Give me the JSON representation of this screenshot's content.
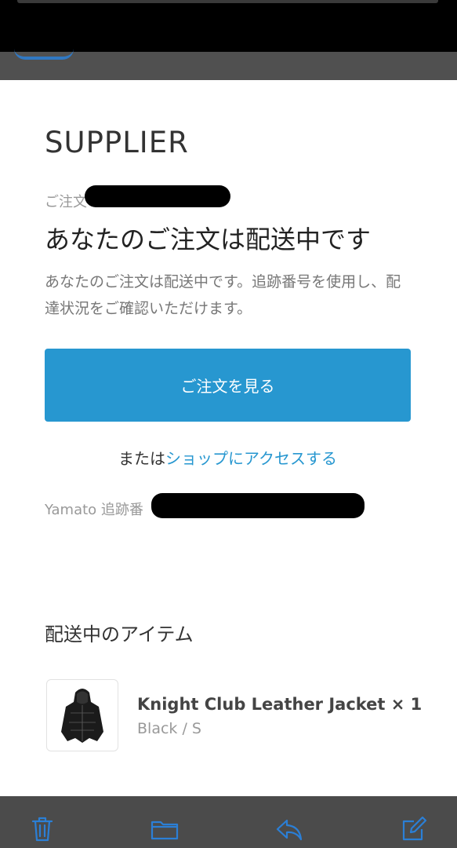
{
  "email": {
    "shop_name": "SUPPLIER",
    "order_number_label": "ご注文",
    "heading": "あなたのご注文は配送中です",
    "description": "あなたのご注文は配送中です。追跡番号を使用し、配達状況をご確認いただけます。",
    "view_order_button": "ご注文を見る",
    "or_text": "または",
    "shop_link": "ショップにアクセスする",
    "tracking_label": "Yamato 追跡番",
    "items_heading": "配送中のアイテム",
    "item": {
      "title": "Knight Club Leather Jacket × 1",
      "variant": "Black / S"
    }
  },
  "toolbar": {
    "icons": [
      "trash-icon",
      "folder-icon",
      "reply-icon",
      "compose-icon"
    ],
    "accent_color": "#2b7fd6"
  },
  "colors": {
    "button": "#2797d0",
    "link": "#2797d0"
  }
}
